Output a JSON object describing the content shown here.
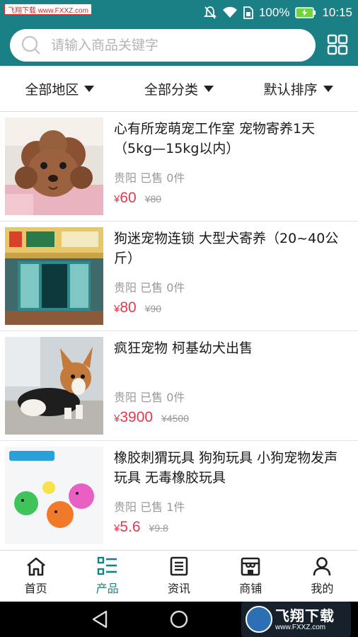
{
  "status_bar": {
    "watermark": "飞翔下载 www.FXXZ.com",
    "battery": "100%",
    "time": "10:15"
  },
  "search": {
    "placeholder": "请输入商品关键字"
  },
  "filters": [
    {
      "label": "全部地区"
    },
    {
      "label": "全部分类"
    },
    {
      "label": "默认排序"
    }
  ],
  "products": [
    {
      "title": "心有所宠萌宠工作室 宠物寄养1天（5kg—15kg以内）",
      "location": "贵阳",
      "sold": "已售 0件",
      "price": "60",
      "original_price": "¥80",
      "image": "brown-poodle-photo"
    },
    {
      "title": "狗迷宠物连锁 大型犬寄养（20~40公斤）",
      "location": "贵阳",
      "sold": "已售 0件",
      "price": "80",
      "original_price": "¥90",
      "image": "pet-store-front-photo"
    },
    {
      "title": "疯狂宠物 柯基幼犬出售",
      "location": "贵阳",
      "sold": "已售 0件",
      "price": "3900",
      "original_price": "¥4500",
      "image": "corgi-puppy-photo"
    },
    {
      "title": "橡胶刺猬玩具 狗狗玩具 小狗宠物发声玩具 无毒橡胶玩具",
      "location": "贵阳",
      "sold": "已售 1件",
      "price": "5.6",
      "original_price": "¥9.8",
      "image": "rubber-hedgehog-toys-photo"
    }
  ],
  "currency_symbol": "¥",
  "tabs": [
    {
      "label": "首页",
      "icon": "home-icon"
    },
    {
      "label": "产品",
      "icon": "list-icon",
      "active": true
    },
    {
      "label": "资讯",
      "icon": "news-icon"
    },
    {
      "label": "商铺",
      "icon": "store-icon"
    },
    {
      "label": "我的",
      "icon": "user-icon"
    }
  ],
  "bottom_watermark": {
    "title": "飞翔下载",
    "url": "www.FXXZ.com"
  },
  "colors": {
    "brand": "#1b7f86",
    "price": "#e1394d"
  }
}
